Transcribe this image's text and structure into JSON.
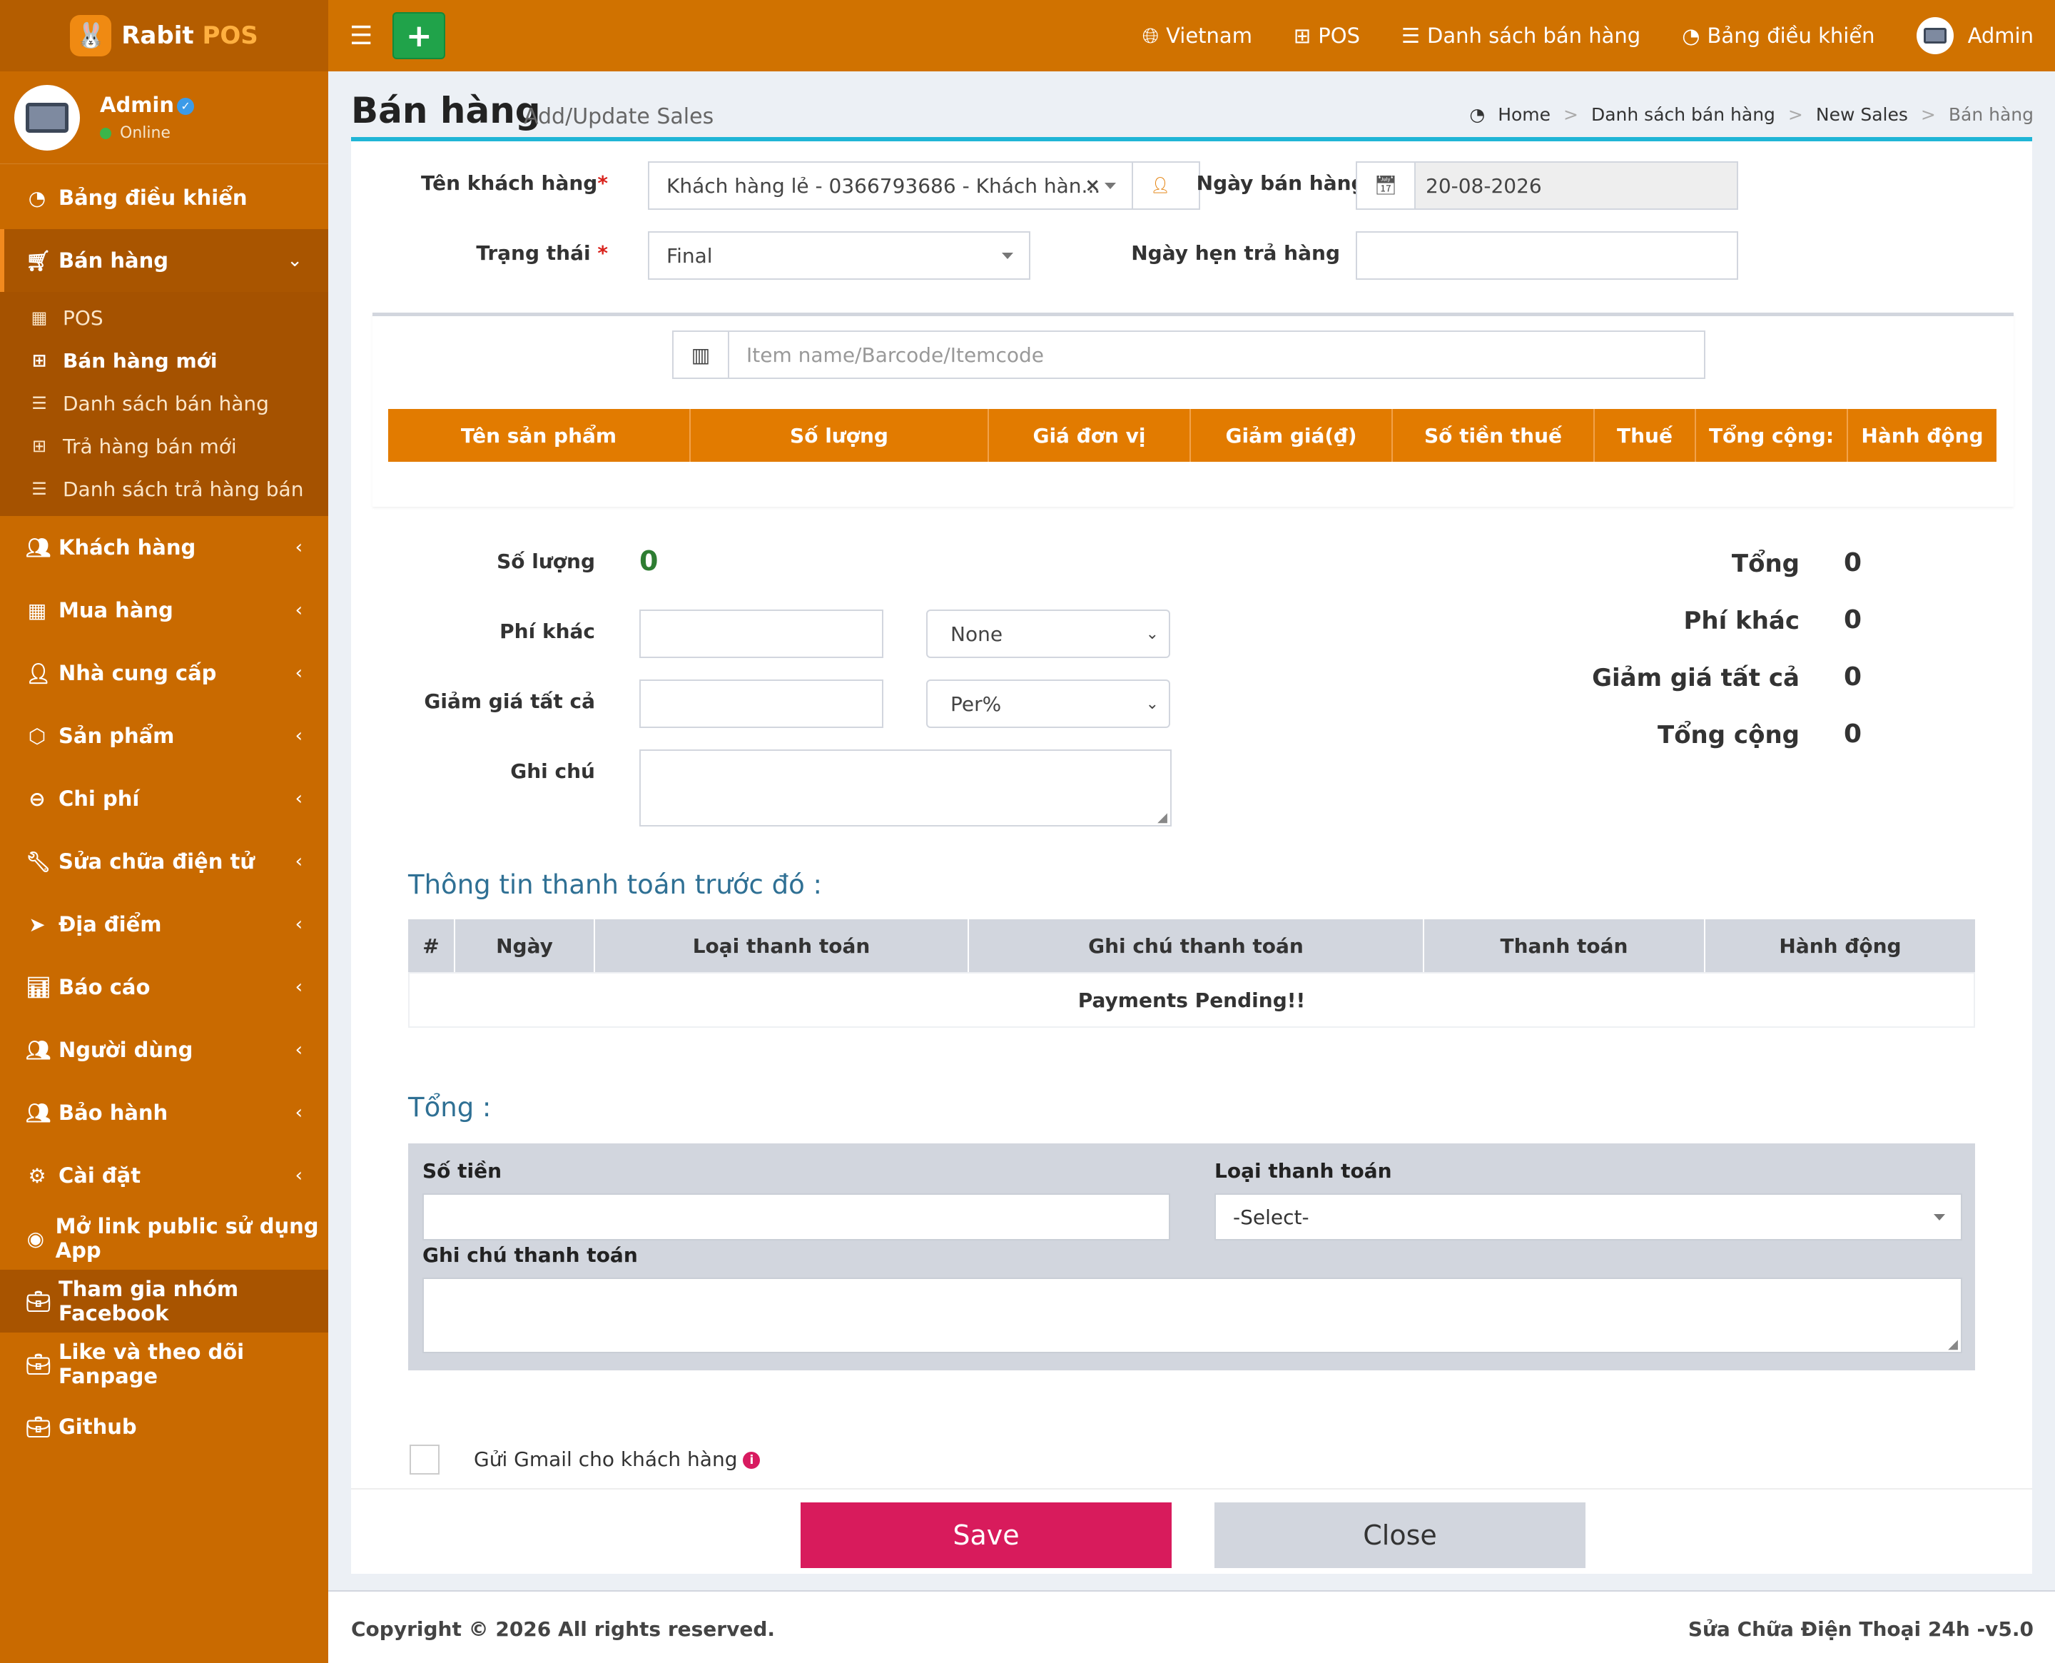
{
  "app": {
    "brand_part1": "Rabit",
    "brand_part2": "POS"
  },
  "colors": {
    "sidebar": "#c96a00",
    "header": "#d07200",
    "table_header": "#e27b00",
    "save": "#d81b5c",
    "accent": "#1fb5d6"
  },
  "user": {
    "name": "Admin",
    "status": "Online"
  },
  "sidebar": {
    "dashboard": "Bảng điều khiển",
    "sales": "Bán hàng",
    "sales_sub": [
      "POS",
      "Bán hàng mới",
      "Danh sách bán hàng",
      "Trả hàng bán mới",
      "Danh sách trả hàng bán"
    ],
    "customers": "Khách hàng",
    "purchases": "Mua hàng",
    "suppliers": "Nhà cung cấp",
    "products": "Sản phẩm",
    "expenses": "Chi phí",
    "repairs": "Sửa chữa điện tử",
    "locations": "Địa điểm",
    "reports": "Báo cáo",
    "users": "Người dùng",
    "warranty": "Bảo hành",
    "settings": "Cài đặt",
    "public_link": "Mở link public sử dụng App",
    "facebook_group": "Tham gia nhóm Facebook",
    "fanpage": "Like và theo dõi Fanpage",
    "github": "Github"
  },
  "topnav": {
    "language": "Vietnam",
    "pos": "POS",
    "sales_list": "Danh sách bán hàng",
    "dashboard": "Bảng điều khiển",
    "user": "Admin",
    "add_symbol": "+"
  },
  "page": {
    "title": "Bán hàng",
    "subtitle": "Add/Update Sales"
  },
  "breadcrumb": [
    "Home",
    "Danh sách bán hàng",
    "New Sales",
    "Bán hàng"
  ],
  "form": {
    "customer_label": "Tên khách hàng",
    "customer_value": "Khách hàng lẻ - 0366793686 - Khách hàn...",
    "date_label": "Ngày bán hàng",
    "date_value": "20-08-2026",
    "status_label": "Trạng thái",
    "status_value": "Final",
    "return_date_label": "Ngày hẹn trả hàng",
    "return_date_value": "",
    "item_placeholder": "Item name/Barcode/Itemcode"
  },
  "items_table": {
    "headers": [
      "Tên sản phẩm",
      "Số lượng",
      "Giá đơn vị",
      "Giảm giá(₫)",
      "Số tiền thuế",
      "Thuế",
      "Tổng cộng:",
      "Hành động"
    ]
  },
  "left_summary": {
    "qty_label": "Số lượng",
    "qty_value": "0",
    "other_fee_label": "Phí khác",
    "other_fee_value": "",
    "other_fee_select": "None",
    "discount_label": "Giảm giá tất cả",
    "discount_value": "",
    "discount_select": "Per%",
    "note_label": "Ghi chú",
    "note_value": ""
  },
  "right_summary": {
    "total_label": "Tổng",
    "total_value": "0",
    "other_fee_label": "Phí khác",
    "other_fee_value": "0",
    "discount_label": "Giảm giá tất cả",
    "discount_value": "0",
    "grand_total_label": "Tổng cộng",
    "grand_total_value": "0"
  },
  "previous_payments": {
    "title": "Thông tin thanh toán trước đó :",
    "headers": [
      "#",
      "Ngày",
      "Loại thanh toán",
      "Ghi chú thanh toán",
      "Thanh toán",
      "Hành động"
    ],
    "empty": "Payments Pending!!"
  },
  "payment": {
    "title": "Tổng :",
    "amount_label": "Số tiền",
    "amount_value": "",
    "type_label": "Loại thanh toán",
    "type_value": "-Select-",
    "note_label": "Ghi chú thanh toán",
    "note_value": ""
  },
  "email_option": {
    "label": "Gửi Gmail cho khách hàng",
    "checked": false
  },
  "actions": {
    "save": "Save",
    "close": "Close"
  },
  "footer": {
    "copyright": "Copyright © 2026 All rights reserved.",
    "version": "Sửa Chữa Điện Thoại 24h -v5.0"
  }
}
